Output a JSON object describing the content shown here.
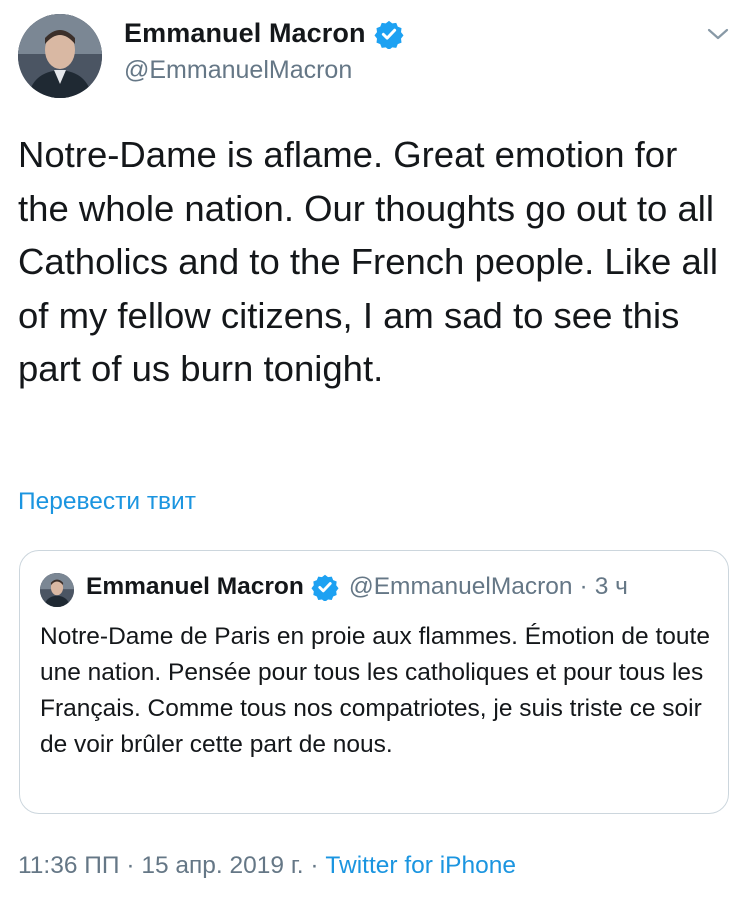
{
  "author": {
    "name": "Emmanuel Macron",
    "handle": "@EmmanuelMacron",
    "verified_icon": "verified-badge-icon",
    "accent_color": "#1da1f2"
  },
  "tweet": {
    "text": "Notre-Dame is aflame. Great emotion for the whole nation. Our thoughts go out to all Catholics and to the French people. Like all of my fellow citizens, I am sad to see this part of us burn tonight.",
    "translate_label": "Перевести твит"
  },
  "quoted_tweet": {
    "name": "Emmanuel Macron",
    "handle": "@EmmanuelMacron",
    "separator": "·",
    "age": "3 ч",
    "text": "Notre-Dame de Paris en proie aux flammes. Émotion de toute une nation. Pensée pour tous les catholiques et pour tous les Français. Comme tous nos compatriotes, je suis triste ce soir de voir brûler cette part de nous."
  },
  "footer": {
    "time": "11:36 ПП",
    "date": "15 апр. 2019 г.",
    "separator": "·",
    "source": "Twitter for iPhone"
  },
  "colors": {
    "text": "#14171a",
    "secondary": "#657786",
    "link": "#1b95e0",
    "border": "#ccd6dd"
  }
}
